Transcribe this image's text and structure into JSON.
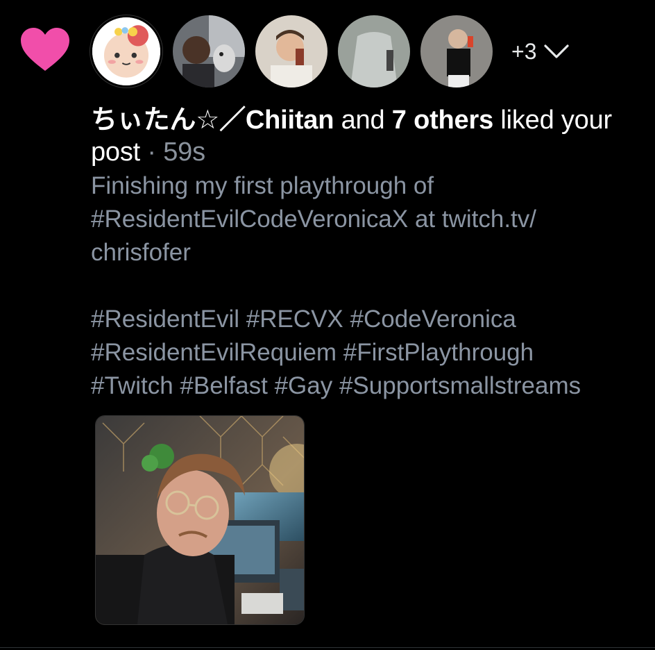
{
  "notification": {
    "icon": "heart-icon",
    "icon_color": "#f14eaa",
    "actor_name": "ちぃたん☆／Chiitan",
    "connector": " and ",
    "others": "7 others",
    "action": " liked your post",
    "separator": " · ",
    "time": "59s",
    "more_count": "+3",
    "expand_icon": "chevron-down-icon"
  },
  "avatars": [
    {
      "name": "avatar-chiitan"
    },
    {
      "name": "avatar-user-2"
    },
    {
      "name": "avatar-user-3"
    },
    {
      "name": "avatar-user-4"
    },
    {
      "name": "avatar-user-5"
    }
  ],
  "post": {
    "text": "Finishing my first playthrough of\n#ResidentEvilCodeVeronicaX at twitch.tv/\nchrisfofer\n\n#ResidentEvil #RECVX #CodeVeronica\n#ResidentEvilRequiem #FirstPlaythrough\n#Twitch #Belfast #Gay #Supportsmallstreams",
    "text_color": "#8b95a3"
  }
}
